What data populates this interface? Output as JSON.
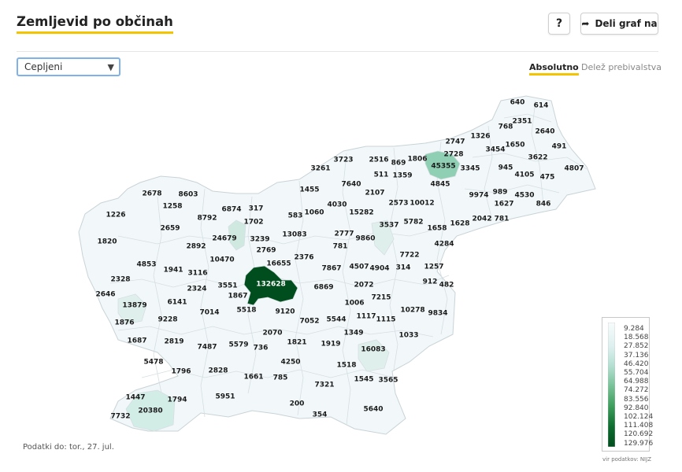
{
  "header": {
    "title": "Zemljevid po občinah",
    "help_label": "?",
    "share_label": "Deli graf na",
    "share_icon": "share-arrow-icon"
  },
  "controls": {
    "select_value": "Cepljeni",
    "toggle_absolute": "Absolutno",
    "toggle_share": "Delež prebivalstva"
  },
  "map": {
    "municipality_values": [
      "640",
      "614",
      "768",
      "2351",
      "1326",
      "2640",
      "2747",
      "3454",
      "1650",
      "491",
      "2728",
      "3622",
      "3261",
      "3723",
      "2516",
      "869",
      "1806",
      "45355",
      "3345",
      "945",
      "4105",
      "4807",
      "511",
      "1359",
      "475",
      "4845",
      "2678",
      "8603",
      "1455",
      "7640",
      "2107",
      "9974",
      "989",
      "4530",
      "1258",
      "6874",
      "317",
      "4030",
      "15282",
      "2573",
      "10012",
      "1627",
      "846",
      "1226",
      "8792",
      "583",
      "1060",
      "2042",
      "781",
      "1702",
      "3537",
      "5782",
      "1658",
      "1628",
      "2659",
      "13083",
      "2777",
      "9860",
      "1820",
      "24679",
      "4284",
      "2892",
      "3239",
      "781",
      "2769",
      "7722",
      "10470",
      "16655",
      "2376",
      "4853",
      "1941",
      "3116",
      "7867",
      "4507",
      "4904",
      "314",
      "1257",
      "2328",
      "3551",
      "132628",
      "912",
      "482",
      "2324",
      "6869",
      "2072",
      "2646",
      "1867",
      "7215",
      "13879",
      "6141",
      "5518",
      "1006",
      "9120",
      "10278",
      "9834",
      "1876",
      "9228",
      "7014",
      "7052",
      "5544",
      "1117",
      "1115",
      "1349",
      "2070",
      "1033",
      "1687",
      "2819",
      "1821",
      "1919",
      "16083",
      "7487",
      "5579",
      "736",
      "5478",
      "4250",
      "1518",
      "1796",
      "2828",
      "1661",
      "785",
      "1545",
      "3565",
      "7321",
      "5951",
      "1447",
      "1794",
      "20380",
      "200",
      "5640",
      "7732",
      "354"
    ],
    "max_value": 132628,
    "colors": {
      "empty": "#f2f8fa",
      "border": "#c9d3d7",
      "dark_green": "#004d1d",
      "highlight_teal": "#8fcfb4"
    }
  },
  "legend": {
    "labels": [
      "9.284",
      "18.568",
      "27.852",
      "37.136",
      "46.420",
      "55.704",
      "64.988",
      "74.272",
      "83.556",
      "92.840",
      "102.124",
      "111.408",
      "120.692",
      "129.976"
    ],
    "gradient_colors": [
      "#f7fbfb",
      "#dcefee",
      "#b3dfd1",
      "#7cc49c",
      "#3b9c5a",
      "#0d6c2f",
      "#004d1d"
    ],
    "source": "vir podatkov: NIJZ"
  },
  "footer": {
    "data_date": "Podatki do: tor., 27. jul."
  }
}
